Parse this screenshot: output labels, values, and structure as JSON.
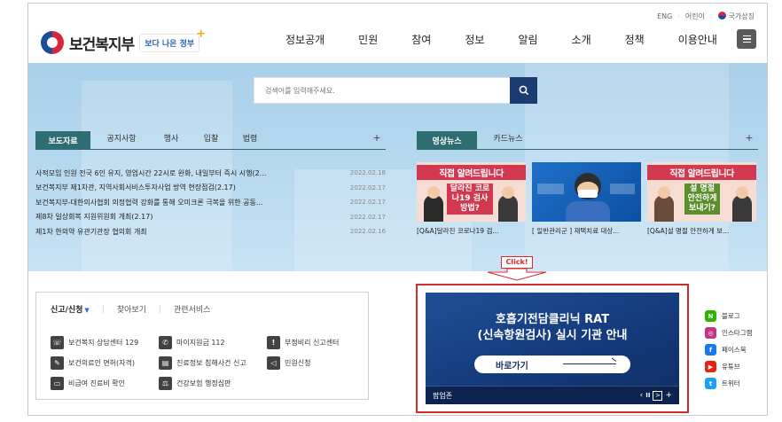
{
  "util": {
    "eng": "ENG",
    "kids": "어린이",
    "national_symbol": "국가상징"
  },
  "brand": {
    "name": "보건복지부",
    "slogan": "보다 나은 정부",
    "slogan_plus": "+"
  },
  "gnb": [
    "정보공개",
    "민원",
    "참여",
    "정보",
    "알림",
    "소개",
    "정책",
    "이용안내"
  ],
  "search": {
    "placeholder": "검색어를 입력해주세요."
  },
  "news": {
    "tabs": [
      "보도자료",
      "공지사항",
      "행사",
      "입찰",
      "법령"
    ],
    "plus": "+",
    "items": [
      {
        "title": "사적모임 인원 전국 6인 유지, 영업시간 22시로 완화, 내일부터 즉시 시행(2...",
        "date": "2022.02.18"
      },
      {
        "title": "보건복지부 제1차관, 지역사회서비스투자사업 방역 현장점검(2.17)",
        "date": "2022.02.17"
      },
      {
        "title": "보건복지부-대한의사협회 의정협력 강화를 통해 오미크론 극복을 위한 공동...",
        "date": "2022.02.17"
      },
      {
        "title": "제8차 일상회복 지원위원회 개최(2.17)",
        "date": "2022.02.17"
      },
      {
        "title": "제1차 한의약 유관기관장 협의회 개최",
        "date": "2022.02.16"
      }
    ]
  },
  "video": {
    "tabs": [
      "영상뉴스",
      "카드뉴스"
    ],
    "plus": "+",
    "items": [
      {
        "thumb_title": "직접 알려드립니다",
        "thumb_sub": "달라진 코로나19 검사 방법?",
        "caption": "[Q&A]달라진 코로나19 검..."
      },
      {
        "thumb_title": "",
        "thumb_sub": "",
        "caption": "[ 일반관리군 ] 재택치료 대상..."
      },
      {
        "thumb_title": "직접 알려드립니다",
        "thumb_sub": "설 명절 안전하게 보내기?",
        "caption": "[Q&A]설 명절 안전하게 보..."
      }
    ]
  },
  "click_label": "Click!",
  "services": {
    "tabs": [
      "신고/신청",
      "찾아보기",
      "관련서비스"
    ],
    "items": [
      {
        "label": "보건복지 상담센터 129",
        "icon": "phone-counsel-icon"
      },
      {
        "label": "마이지원금 112",
        "icon": "phone-icon"
      },
      {
        "label": "부정비리 신고센터",
        "icon": "report-icon"
      },
      {
        "label": "보건의료인 면허(자격)",
        "icon": "pen-icon"
      },
      {
        "label": "진료정보 침해사건 신고",
        "icon": "clipboard-icon"
      },
      {
        "label": "민원신청",
        "icon": "megaphone-icon"
      },
      {
        "label": "비급여 진료비 확인",
        "icon": "card-icon"
      },
      {
        "label": "건강보험 행정심판",
        "icon": "gavel-icon"
      }
    ]
  },
  "banner": {
    "title_line1": "호흡기전담클리닉 RAT",
    "title_line2": "(신속항원검사) 실시 기관 안내",
    "button": "바로가기",
    "popup_zone": "팝업존",
    "controls": {
      "prev": "‹",
      "pause": "II",
      "next": ">",
      "plus": "+"
    }
  },
  "sns": [
    {
      "label": "블로그",
      "letter": "N",
      "color": "#2db400"
    },
    {
      "label": "인스타그램",
      "letter": "◎",
      "color": "#c13584"
    },
    {
      "label": "페이스북",
      "letter": "f",
      "color": "#1877f2"
    },
    {
      "label": "유튜브",
      "letter": "▶",
      "color": "#e62117"
    },
    {
      "label": "트위터",
      "letter": "t",
      "color": "#1da1f2"
    }
  ]
}
